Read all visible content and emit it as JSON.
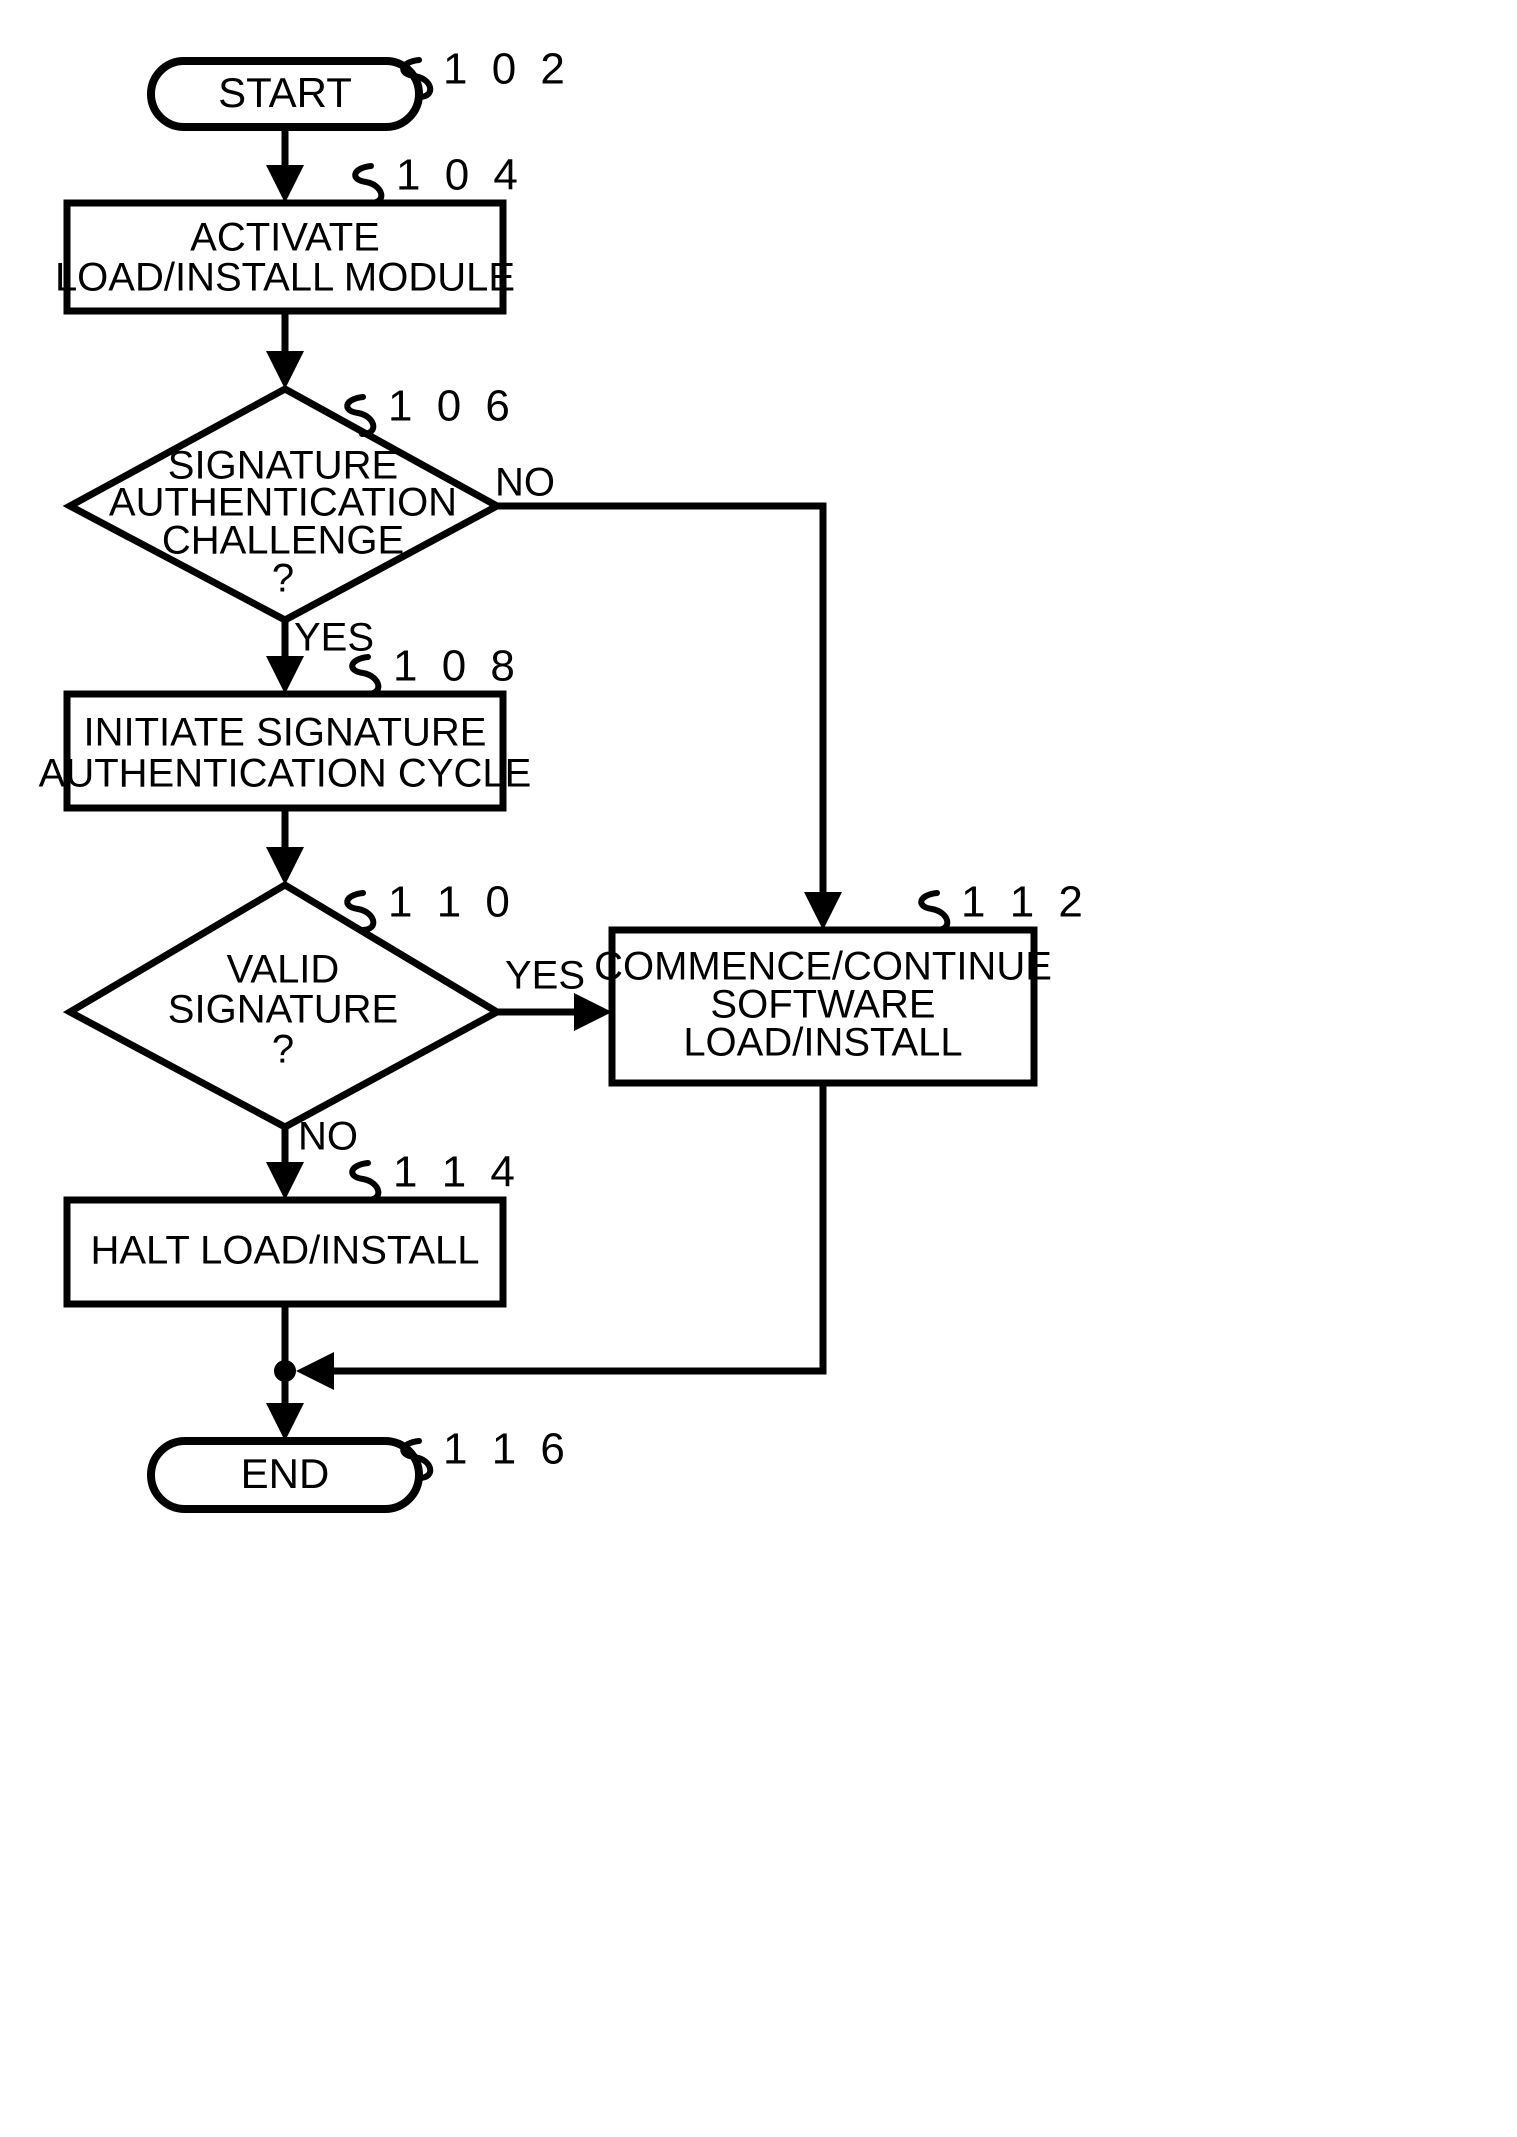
{
  "figure": {
    "type": "patent-flowchart",
    "background_color": "#ffffff",
    "line_color": "#000000"
  },
  "nodes": {
    "start": {
      "ref": "1 0 2",
      "label": "START",
      "shape": "terminator"
    },
    "activate": {
      "ref": "1 0 4",
      "line1": "ACTIVATE",
      "line2": "LOAD/INSTALL MODULE",
      "shape": "process"
    },
    "sig_challenge": {
      "ref": "1 0 6",
      "line1": "SIGNATURE",
      "line2": "AUTHENTICATION",
      "line3": "CHALLENGE",
      "line4": "?",
      "shape": "decision"
    },
    "initiate": {
      "ref": "1 0 8",
      "line1": "INITIATE SIGNATURE",
      "line2": "AUTHENTICATION CYCLE",
      "shape": "process"
    },
    "valid_sig": {
      "ref": "1 1 0",
      "line1": "VALID",
      "line2": "SIGNATURE",
      "line3": "?",
      "shape": "decision"
    },
    "commence": {
      "ref": "1 1 2",
      "line1": "COMMENCE/CONTINUE",
      "line2": "SOFTWARE",
      "line3": "LOAD/INSTALL",
      "shape": "process"
    },
    "halt": {
      "ref": "1 1 4",
      "line1": "HALT LOAD/INSTALL",
      "shape": "process"
    },
    "end": {
      "ref": "1 1 6",
      "label": "END",
      "shape": "terminator"
    }
  },
  "branch_labels": {
    "challenge_no": "NO",
    "challenge_yes": "YES",
    "valid_yes": "YES",
    "valid_no": "NO"
  }
}
